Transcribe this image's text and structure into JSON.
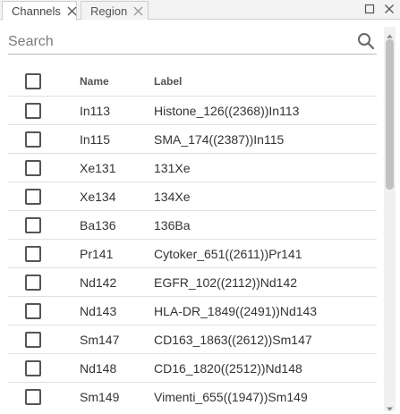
{
  "tabs": [
    {
      "label": "Channels",
      "active": true
    },
    {
      "label": "Region",
      "active": false
    }
  ],
  "search": {
    "placeholder": "Search",
    "value": ""
  },
  "table": {
    "headers": {
      "name": "Name",
      "label": "Label"
    },
    "rows": [
      {
        "name": "In113",
        "label": "Histone_126((2368))In113"
      },
      {
        "name": "In115",
        "label": "SMA_174((2387))In115"
      },
      {
        "name": "Xe131",
        "label": "131Xe"
      },
      {
        "name": "Xe134",
        "label": "134Xe"
      },
      {
        "name": "Ba136",
        "label": "136Ba"
      },
      {
        "name": "Pr141",
        "label": "Cytoker_651((2611))Pr141"
      },
      {
        "name": "Nd142",
        "label": "EGFR_102((2112))Nd142"
      },
      {
        "name": "Nd143",
        "label": "HLA-DR_1849((2491))Nd143"
      },
      {
        "name": "Sm147",
        "label": "CD163_1863((2612))Sm147"
      },
      {
        "name": "Nd148",
        "label": "CD16_1820((2512))Nd148"
      },
      {
        "name": "Sm149",
        "label": "Vimenti_655((1947))Sm149"
      }
    ]
  },
  "icons": {
    "tab_close": "close-icon",
    "maximize": "maximize-icon",
    "window_close": "close-icon",
    "search": "search-icon"
  },
  "colors": {
    "accent": "#555555",
    "tab_bg": "#f3f3f3",
    "divider": "#e0e0e0"
  }
}
